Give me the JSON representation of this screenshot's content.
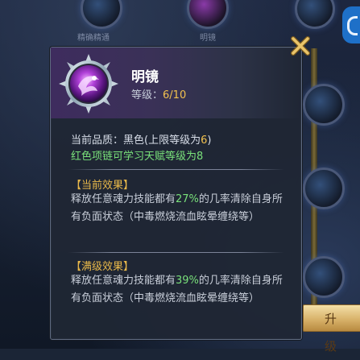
{
  "background": {
    "top_labels": [
      "精确精通",
      "明镜"
    ],
    "upgrade_button_label": "升 级"
  },
  "tooltip": {
    "item_name": "明镜",
    "level_label": "等级：",
    "level_value": "6/10",
    "quality_label": "当前品质：",
    "quality_value": "黑色",
    "quality_limit_open": "(上限等级为",
    "quality_limit_num": "6",
    "quality_limit_close": ")",
    "talent_hint": "红色项链可学习天赋等级为8",
    "current_effect": {
      "title": "【当前效果】",
      "text_before": "释放任意魂力技能都有",
      "percent": "27%",
      "text_after": "的几率清除自身所有负面状态（中毒燃烧流血眩晕缠绕等）"
    },
    "max_effect": {
      "title": "【满级效果】",
      "text_before": "释放任意魂力技能都有",
      "percent": "39%",
      "text_after": "的几率清除自身所有负面状态（中毒燃烧流血眩晕缠绕等）"
    },
    "close_icon": "close-x-icon"
  },
  "colors": {
    "accent_gold": "#f2c14e",
    "green": "#79e07a",
    "section_title": "#e8b84a"
  }
}
